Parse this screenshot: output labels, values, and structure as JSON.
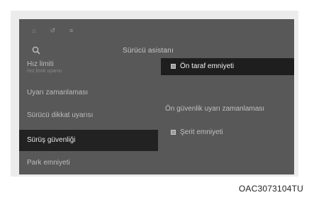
{
  "screen": {
    "title": "Sürücü asistanı",
    "top_icons": [
      "⌂",
      "↺",
      "≡"
    ]
  },
  "sidebar": {
    "items": [
      {
        "label": "Hız limiti",
        "sub": "Hız limiti uyarısı"
      },
      {
        "label": "Uyarı zamanlaması"
      },
      {
        "label": "Sürücü dikkat uyarısı"
      },
      {
        "label": "Sürüş güvenliği"
      },
      {
        "label": "Park emniyeti"
      }
    ]
  },
  "panel": {
    "items": [
      {
        "label": "Ön taraf emniyeti"
      },
      {
        "label": "Ön güvenlik uyarı zamanlaması"
      },
      {
        "label": "Şerit emniyeti"
      }
    ]
  },
  "caption": {
    "code": "OAC3073104TU"
  }
}
